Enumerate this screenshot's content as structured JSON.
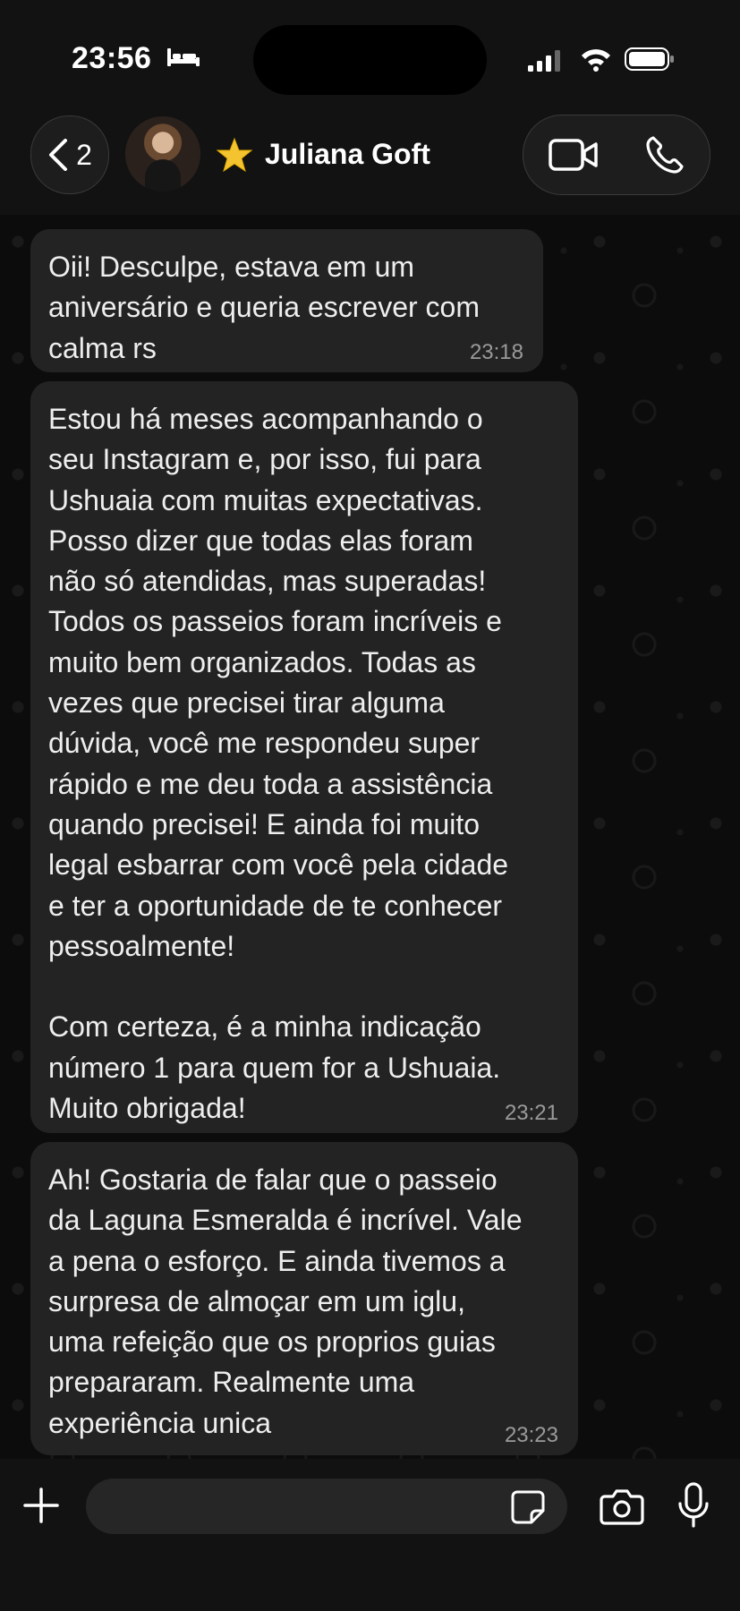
{
  "status_bar": {
    "time": "23:56",
    "icons": [
      "bed-icon",
      "signal-icon",
      "wifi-icon",
      "battery-icon"
    ]
  },
  "header": {
    "back_count": "2",
    "contact_name": "Juliana Goft",
    "icons": [
      "chevron-left-icon",
      "star-icon",
      "video-icon",
      "phone-icon"
    ]
  },
  "messages": [
    {
      "text": "Oii! Desculpe, estava em um\naniversário e queria escrever com\ncalma rs",
      "time": "23:18"
    },
    {
      "text": "Estou há meses acompanhando o\nseu Instagram e, por isso, fui para\nUshuaia com muitas expectativas.\nPosso dizer que todas elas foram\nnão só atendidas, mas superadas!\nTodos os passeios foram incríveis e\nmuito bem organizados. Todas as\nvezes que precisei tirar alguma\ndúvida, você me respondeu super\nrápido e me deu toda a assistência\nquando precisei! E ainda foi muito\nlegal esbarrar com você pela cidade\ne ter a oportunidade de te conhecer\npessoalmente!\n\nCom certeza, é a minha indicação\nnúmero 1 para quem for a Ushuaia.\nMuito obrigada!",
      "time": "23:21"
    },
    {
      "text": "Ah! Gostaria de falar que o passeio\nda Laguna Esmeralda é incrível. Vale\na pena o esforço. E ainda tivemos a\nsurpresa de almoçar em um iglu,\numa refeição que os proprios guias\nprepararam. Realmente uma\nexperiência unica",
      "time": "23:23"
    }
  ],
  "composer": {
    "input_value": "",
    "icons": [
      "plus-icon",
      "sticker-icon",
      "camera-icon",
      "mic-icon"
    ]
  },
  "colors": {
    "background": "#0b0b0b",
    "bubble": "#232323",
    "text": "#eeeeee",
    "timestamp": "#9a9a9a"
  }
}
